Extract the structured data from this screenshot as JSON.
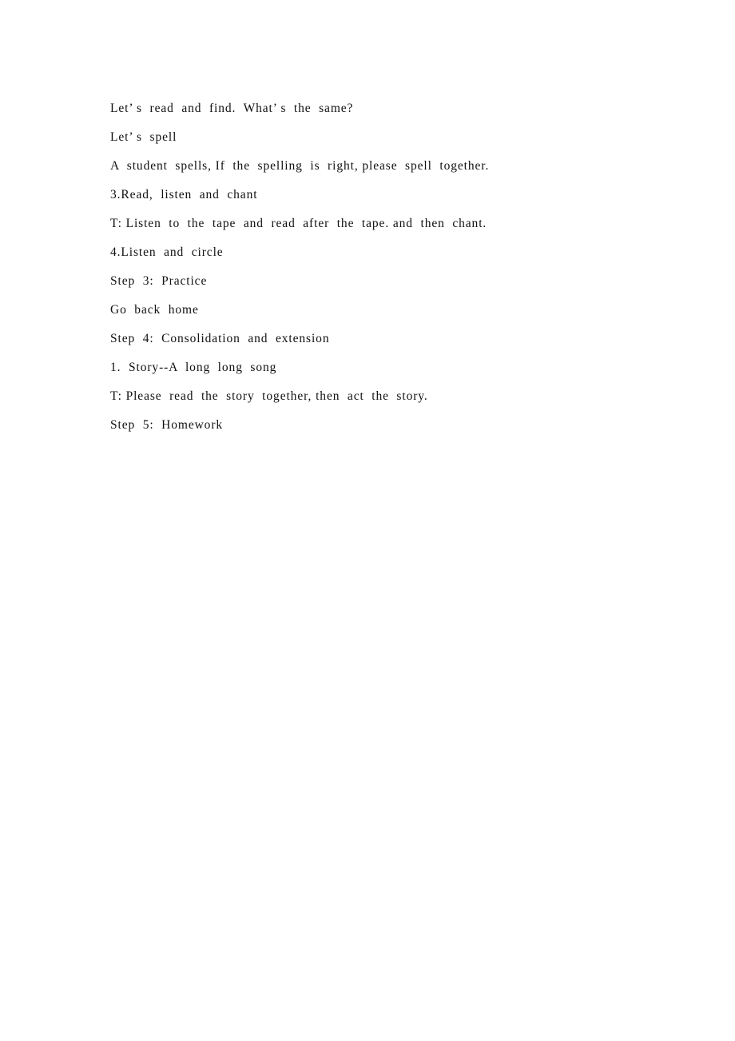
{
  "document": {
    "page_background": "#ffffff",
    "text_color": "#111111",
    "lines": [
      {
        "id": "line-1",
        "text": "Let’ s  read  and  find.  What’ s  the  same?"
      },
      {
        "id": "line-2",
        "text": "Let’ s  spell"
      },
      {
        "id": "line-3",
        "text": "A  student  spells, If  the  spelling  is  right, please  spell  together."
      },
      {
        "id": "line-4",
        "text": "3.Read,  listen  and  chant"
      },
      {
        "id": "line-5",
        "text": "T: Listen  to  the  tape  and  read  after  the  tape. and  then  chant."
      },
      {
        "id": "line-6",
        "text": "4.Listen  and  circle"
      },
      {
        "id": "line-7",
        "text": "Step  3:  Practice"
      },
      {
        "id": "line-8",
        "text": "Go  back  home"
      },
      {
        "id": "line-9",
        "text": "Step  4:  Consolidation  and  extension"
      },
      {
        "id": "line-10",
        "text": "1.  Story--A  long  long  song"
      },
      {
        "id": "line-11",
        "text": "T: Please  read  the  story  together, then  act  the  story."
      },
      {
        "id": "line-12",
        "text": "Step  5:  Homework"
      }
    ]
  }
}
